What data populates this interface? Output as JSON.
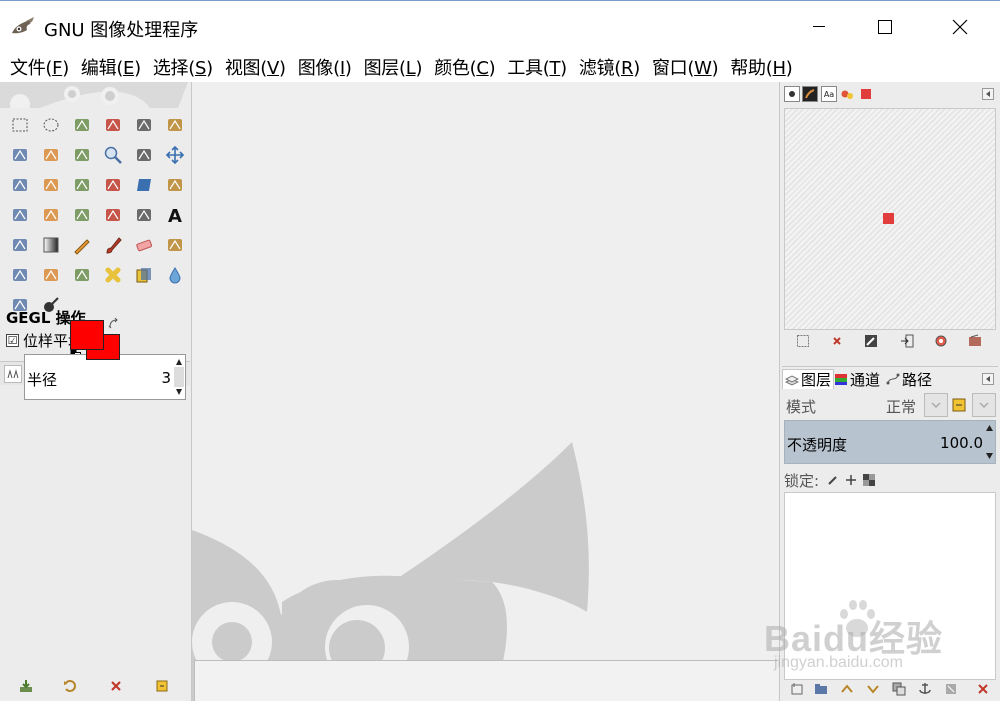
{
  "window": {
    "title": "GNU 图像处理程序"
  },
  "menubar": [
    {
      "label": "文件(",
      "mnemonic": "F",
      "tail": ")"
    },
    {
      "label": "编辑(",
      "mnemonic": "E",
      "tail": ")"
    },
    {
      "label": "选择(",
      "mnemonic": "S",
      "tail": ")"
    },
    {
      "label": "视图(",
      "mnemonic": "V",
      "tail": ")"
    },
    {
      "label": "图像(",
      "mnemonic": "I",
      "tail": ")"
    },
    {
      "label": "图层(",
      "mnemonic": "L",
      "tail": ")"
    },
    {
      "label": "颜色(",
      "mnemonic": "C",
      "tail": ")"
    },
    {
      "label": "工具(",
      "mnemonic": "T",
      "tail": ")"
    },
    {
      "label": "滤镜(",
      "mnemonic": "R",
      "tail": ")"
    },
    {
      "label": "窗口(",
      "mnemonic": "W",
      "tail": ")"
    },
    {
      "label": "帮助(",
      "mnemonic": "H",
      "tail": ")"
    }
  ],
  "toolbox": {
    "tools": [
      "rect-select-icon",
      "ellipse-select-icon",
      "free-select-icon",
      "fuzzy-select-icon",
      "select-by-color-icon",
      "scissors-icon",
      "foreground-select-icon",
      "paths-icon",
      "color-picker-icon",
      "zoom-icon",
      "measure-icon",
      "move-icon",
      "align-icon",
      "crop-icon",
      "rotate-icon",
      "scale-icon",
      "shear-icon",
      "perspective-icon",
      "unified-transform-icon",
      "warp-transform-icon",
      "flip-icon",
      "cage-icon",
      "handle-transform-icon",
      "text-icon",
      "bucket-fill-icon",
      "gradient-icon",
      "pencil-icon",
      "paintbrush-icon",
      "eraser-icon",
      "airbrush-icon",
      "ink-icon",
      "mypaint-brush-icon",
      "clone-icon",
      "heal-icon",
      "perspective-clone-icon",
      "blur-icon",
      "smudge-icon",
      "dodge-burn-icon"
    ],
    "colors": {
      "foreground": "#ff0000",
      "background": "#ff0000"
    }
  },
  "tool_options": {
    "title": "GEGL 操作",
    "sampling_label": "位样平均",
    "sampling_checked": "☑",
    "radius_label": "半径",
    "radius_value": "3"
  },
  "brushes": {
    "dot_color": "#e23d3d"
  },
  "layers": {
    "tabs": [
      "图层",
      "通道",
      "路径"
    ],
    "mode_label": "模式",
    "mode_value": "正常",
    "opacity_label": "不透明度",
    "opacity_value": "100.0",
    "lock_label": "锁定:"
  },
  "watermark": {
    "main": "Baidu经验",
    "sub": "jingyan.baidu.com"
  }
}
